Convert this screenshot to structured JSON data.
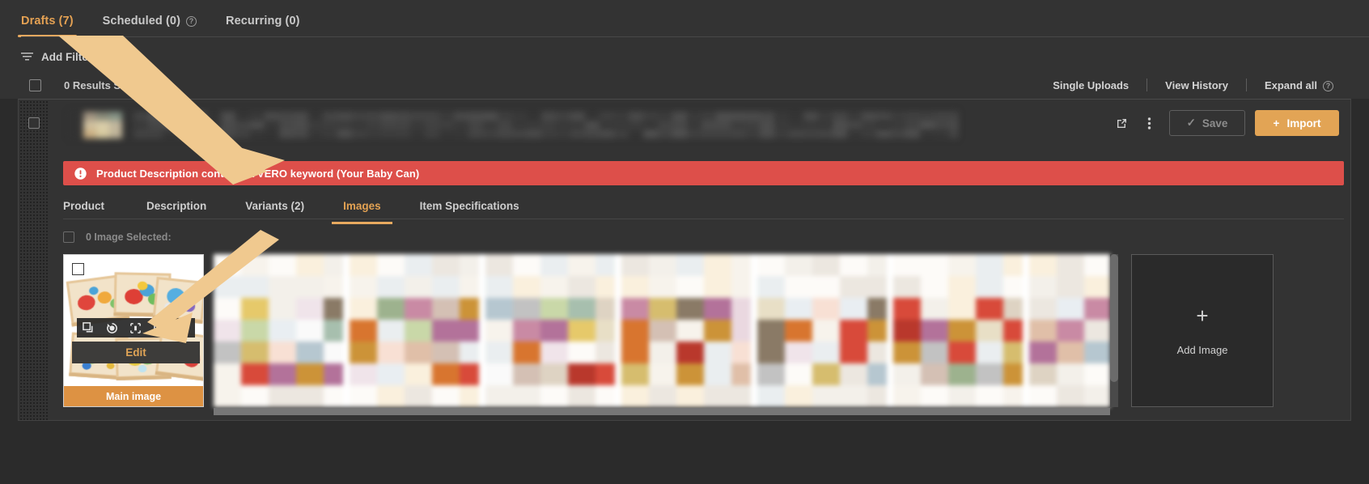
{
  "top_tabs": [
    {
      "label": "Drafts (7)",
      "active": true,
      "help": false
    },
    {
      "label": "Scheduled (0)",
      "active": false,
      "help": true,
      "help_glyph": "?"
    },
    {
      "label": "Recurring (0)",
      "active": false,
      "help": false
    }
  ],
  "filter": {
    "label": "Add Filter",
    "icon": "filter-icon"
  },
  "results": {
    "selected_label": "0 Results Selected",
    "links": [
      "Single Uploads",
      "View History",
      "Expand all"
    ],
    "expand_help_glyph": "?"
  },
  "row": {
    "actions": {
      "open_external_icon": "external-link-icon",
      "more_icon": "kebab-menu-icon",
      "save_label": "Save",
      "save_check_glyph": "✓",
      "import_label": "Import",
      "import_plus_glyph": "+"
    }
  },
  "banner": {
    "icon": "error-circle-icon",
    "text": "Product Description contains a VERO keyword (Your Baby Can)",
    "color": "#dd4f4a"
  },
  "inner_tabs": [
    {
      "label": "Product",
      "active": false
    },
    {
      "label": "Description",
      "active": false
    },
    {
      "label": "Variants (2)",
      "active": false
    },
    {
      "label": "Images",
      "active": true
    },
    {
      "label": "Item Specifications",
      "active": false
    }
  ],
  "images_panel": {
    "selected_label": "0 Image Selected:",
    "card": {
      "toolbar_icons": [
        "copy-icon",
        "rotate-icon",
        "crop-icon",
        "resize-icon",
        "expand-icon"
      ],
      "edit_label": "Edit",
      "main_image_label": "Main image"
    },
    "add_image": {
      "plus_glyph": "+",
      "label": "Add Image"
    }
  },
  "colors": {
    "accent": "#e7a95f",
    "accent_button": "#e2a455",
    "main_image_bar": "#dd9243",
    "error": "#dd4f4a",
    "background": "#2b2b2b",
    "panel": "#333333",
    "annotation_arrow": "#f0c98f"
  }
}
